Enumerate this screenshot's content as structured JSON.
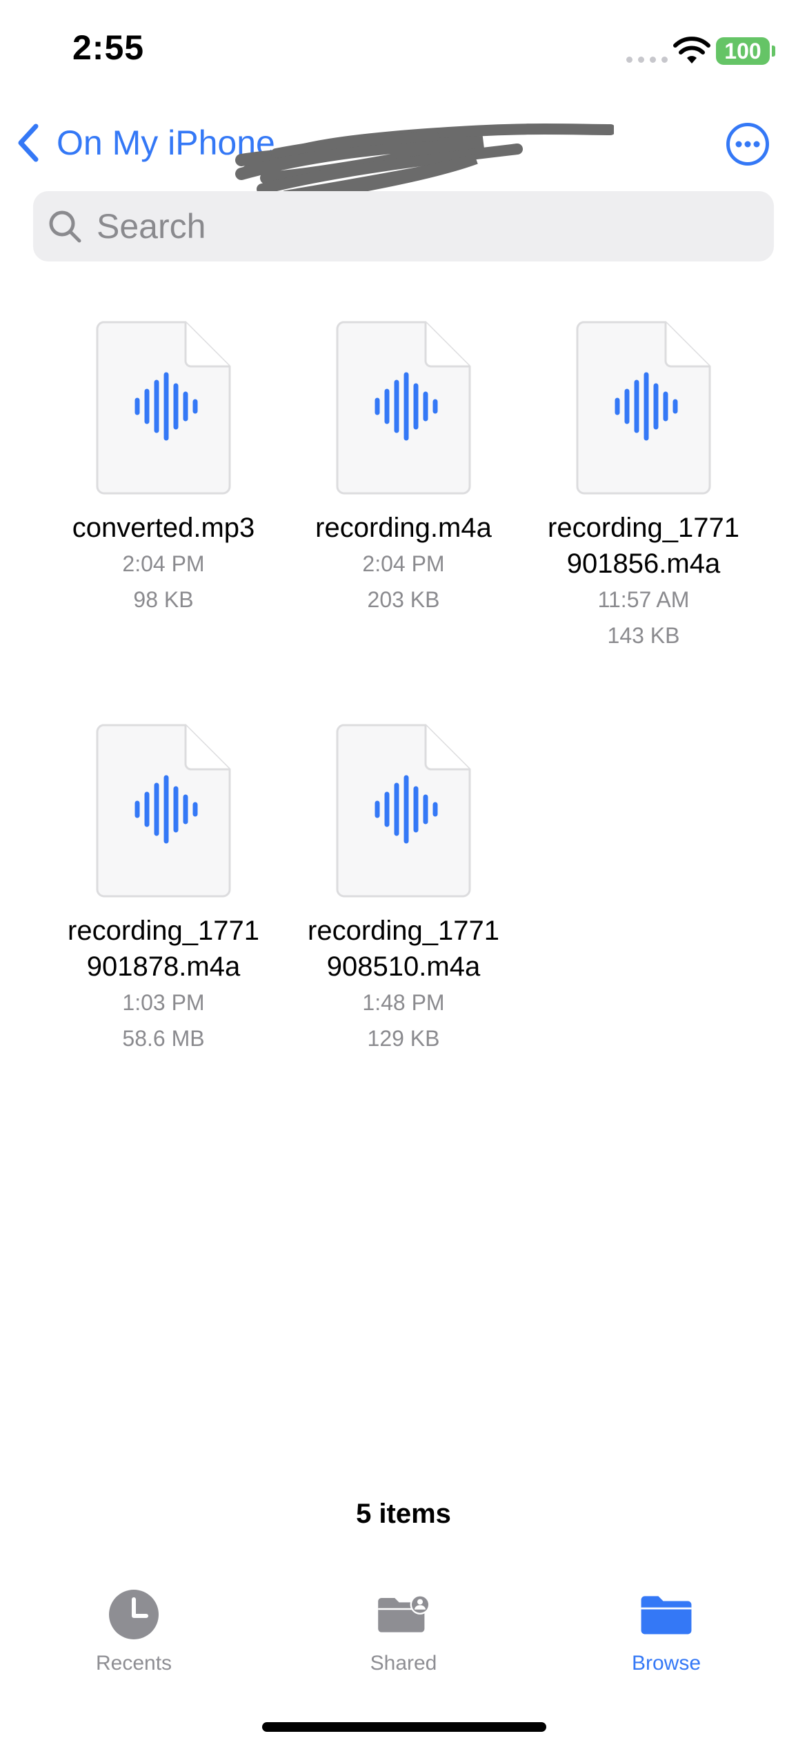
{
  "status_bar": {
    "time": "2:55",
    "battery": "100"
  },
  "nav": {
    "back_label": "On My iPhone",
    "more_icon": "ellipsis-circle-icon"
  },
  "search": {
    "placeholder": "Search"
  },
  "files": [
    {
      "name": "converted.mp3",
      "time": "2:04 PM",
      "size": "98 KB"
    },
    {
      "name": "recording.m4a",
      "time": "2:04 PM",
      "size": "203 KB"
    },
    {
      "name_line1": "recording_1771",
      "name_line2": "901856.m4a",
      "time": "11:57 AM",
      "size": "143 KB"
    },
    {
      "name_line1": "recording_1771",
      "name_line2": "901878.m4a",
      "time": "1:03 PM",
      "size": "58.6 MB"
    },
    {
      "name_line1": "recording_1771",
      "name_line2": "908510.m4a",
      "time": "1:48 PM",
      "size": "129 KB"
    }
  ],
  "footer": {
    "items_count": "5 items"
  },
  "tabbar": {
    "recents": "Recents",
    "shared": "Shared",
    "browse": "Browse",
    "active_color": "#3478f6",
    "inactive_color": "#8e8e93"
  },
  "colors": {
    "accent": "#3478f6",
    "battery": "#65c466"
  }
}
